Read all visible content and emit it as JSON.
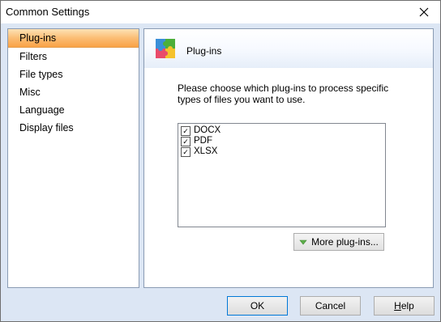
{
  "window": {
    "title": "Common Settings",
    "close_icon": "close-icon"
  },
  "sidebar": {
    "items": [
      {
        "label": "Plug-ins",
        "selected": true
      },
      {
        "label": "Filters"
      },
      {
        "label": "File types"
      },
      {
        "label": "Misc"
      },
      {
        "label": "Language"
      },
      {
        "label": "Display files"
      }
    ]
  },
  "panel": {
    "title": "Plug-ins",
    "icon": "puzzle-icon",
    "description": "Please choose which plug-ins to process specific types of files you want to use.",
    "plugins": [
      {
        "label": "DOCX",
        "checked": true
      },
      {
        "label": "PDF",
        "checked": true
      },
      {
        "label": "XLSX",
        "checked": true
      }
    ],
    "more_button": "More plug-ins..."
  },
  "buttons": {
    "ok": "OK",
    "cancel": "Cancel",
    "help_first": "H",
    "help_rest": "elp"
  },
  "colors": {
    "selected_item": "#f9a246",
    "window_bg": "#dce6f4",
    "border": "#8a9bb3"
  }
}
